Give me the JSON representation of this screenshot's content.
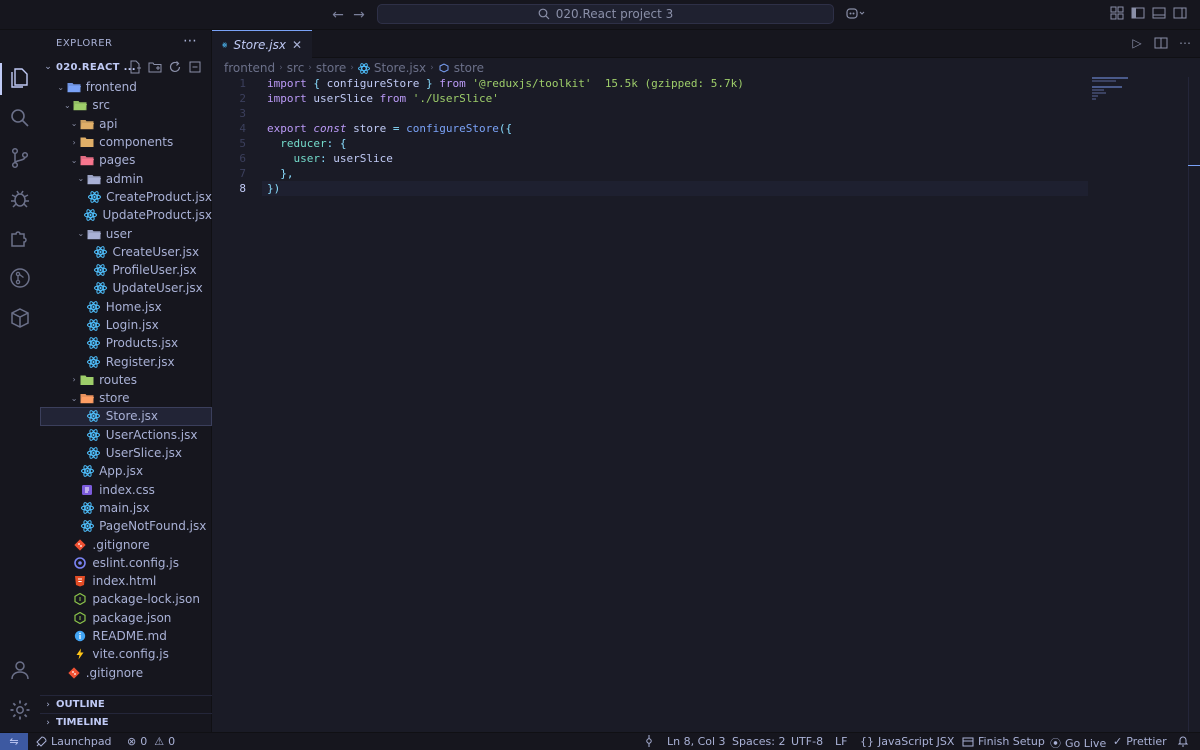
{
  "titlebar": {
    "search_text": "020.React project 3"
  },
  "activity": [
    "explorer-icon",
    "search-icon",
    "source-control-icon",
    "debug-icon",
    "extensions-icon",
    "gitlens-icon",
    "containers-icon",
    "account-icon",
    "settings-icon"
  ],
  "explorer": {
    "header": "EXPLORER",
    "root_label": "020.REACT ...",
    "tree": [
      {
        "label": "frontend",
        "depth": 1,
        "kind": "folder-open",
        "color": "#7aa2f7"
      },
      {
        "label": "src",
        "depth": 2,
        "kind": "folder-open",
        "color": "#9ece6a"
      },
      {
        "label": "api",
        "depth": 3,
        "kind": "folder-open",
        "color": "#e0af68"
      },
      {
        "label": "components",
        "depth": 3,
        "kind": "folder-closed",
        "color": "#e0af68"
      },
      {
        "label": "pages",
        "depth": 3,
        "kind": "folder-open",
        "color": "#f7768e"
      },
      {
        "label": "admin",
        "depth": 4,
        "kind": "folder-open",
        "color": "#a9b1d6"
      },
      {
        "label": "CreateProduct.jsx",
        "depth": 5,
        "kind": "react"
      },
      {
        "label": "UpdateProduct.jsx",
        "depth": 5,
        "kind": "react"
      },
      {
        "label": "user",
        "depth": 4,
        "kind": "folder-open",
        "color": "#a9b1d6"
      },
      {
        "label": "CreateUser.jsx",
        "depth": 5,
        "kind": "react"
      },
      {
        "label": "ProfileUser.jsx",
        "depth": 5,
        "kind": "react"
      },
      {
        "label": "UpdateUser.jsx",
        "depth": 5,
        "kind": "react"
      },
      {
        "label": "Home.jsx",
        "depth": 4,
        "kind": "react"
      },
      {
        "label": "Login.jsx",
        "depth": 4,
        "kind": "react"
      },
      {
        "label": "Products.jsx",
        "depth": 4,
        "kind": "react"
      },
      {
        "label": "Register.jsx",
        "depth": 4,
        "kind": "react"
      },
      {
        "label": "routes",
        "depth": 3,
        "kind": "folder-closed",
        "color": "#9ece6a"
      },
      {
        "label": "store",
        "depth": 3,
        "kind": "folder-open",
        "color": "#ff9e64"
      },
      {
        "label": "Store.jsx",
        "depth": 4,
        "kind": "react",
        "selected": true
      },
      {
        "label": "UserActions.jsx",
        "depth": 4,
        "kind": "react"
      },
      {
        "label": "UserSlice.jsx",
        "depth": 4,
        "kind": "react"
      },
      {
        "label": "App.jsx",
        "depth": 3,
        "kind": "react"
      },
      {
        "label": "index.css",
        "depth": 3,
        "kind": "css"
      },
      {
        "label": "main.jsx",
        "depth": 3,
        "kind": "react"
      },
      {
        "label": "PageNotFound.jsx",
        "depth": 3,
        "kind": "react"
      },
      {
        "label": ".gitignore",
        "depth": 2,
        "kind": "git"
      },
      {
        "label": "eslint.config.js",
        "depth": 2,
        "kind": "eslint"
      },
      {
        "label": "index.html",
        "depth": 2,
        "kind": "html"
      },
      {
        "label": "package-lock.json",
        "depth": 2,
        "kind": "node"
      },
      {
        "label": "package.json",
        "depth": 2,
        "kind": "node"
      },
      {
        "label": "README.md",
        "depth": 2,
        "kind": "info"
      },
      {
        "label": "vite.config.js",
        "depth": 2,
        "kind": "vite"
      },
      {
        "label": ".gitignore",
        "depth": 1,
        "kind": "git"
      }
    ],
    "outline_label": "OUTLINE",
    "timeline_label": "TIMELINE"
  },
  "editor": {
    "tab_label": "Store.jsx",
    "breadcrumb": [
      "frontend",
      "src",
      "store",
      "Store.jsx",
      "store"
    ],
    "line_numbers": [
      "1",
      "2",
      "3",
      "4",
      "5",
      "6",
      "7",
      "8"
    ],
    "current_line": 8,
    "import_size_hint": "15.5k (gzipped: 5.7k)"
  },
  "status": {
    "launchpad": "Launchpad",
    "errors": "0",
    "warnings": "0",
    "cursor": "Ln 8, Col 3",
    "spaces": "Spaces: 2",
    "encoding": "UTF-8",
    "eol": "LF",
    "language": "JavaScript JSX",
    "finish_setup": "Finish Setup",
    "go_live": "Go Live",
    "prettier": "Prettier"
  }
}
